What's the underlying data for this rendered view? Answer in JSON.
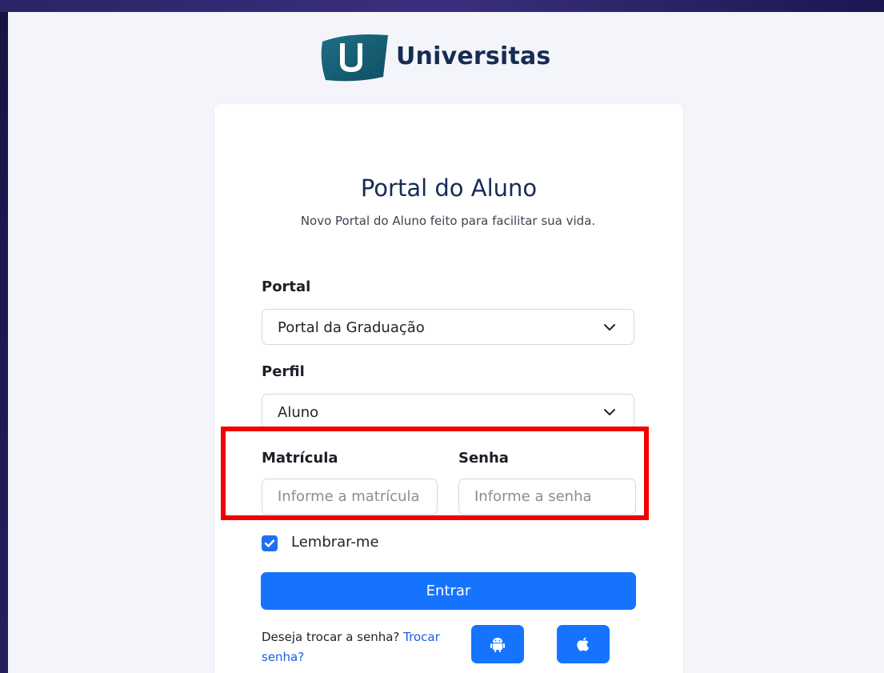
{
  "brand": {
    "name": "Universitas",
    "logo_icon": "universitas-u-logo-icon"
  },
  "header": {
    "title": "Portal do Aluno",
    "subtitle": "Novo Portal do Aluno feito para facilitar sua vida."
  },
  "form": {
    "portal": {
      "label": "Portal",
      "value": "Portal da Graduação",
      "icon": "chevron-down-icon"
    },
    "perfil": {
      "label": "Perfil",
      "value": "Aluno",
      "icon": "chevron-down-icon"
    },
    "matricula": {
      "label": "Matrícula",
      "placeholder": "Informe a matrícula",
      "value": ""
    },
    "senha": {
      "label": "Senha",
      "placeholder": "Informe a senha",
      "value": ""
    },
    "remember": {
      "label": "Lembrar-me",
      "checked": true
    },
    "submit_label": "Entrar",
    "change_password": {
      "text": "Deseja trocar a senha?",
      "link": "Trocar senha?"
    }
  },
  "apps": [
    {
      "icon": "android-icon"
    },
    {
      "icon": "apple-icon"
    }
  ],
  "colors": {
    "accent": "#1673fe",
    "title": "#172c52",
    "highlight": "#f00000",
    "backdrop": "#211c52"
  }
}
